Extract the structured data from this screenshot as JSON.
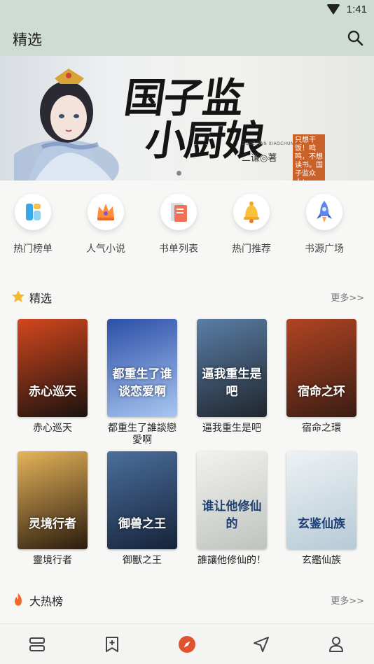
{
  "status": {
    "time": "1:41"
  },
  "appbar": {
    "title": "精选"
  },
  "banner": {
    "title_line1": "国子监",
    "title_line2": "小厨娘",
    "author": "二谦◎著",
    "pinyin": "GUOZIJIAN XIAOCHUNIANG",
    "tagline": "只想干饭！鸣鸣，不想读书。国子监众人："
  },
  "shortcuts": [
    {
      "label": "热门榜单",
      "icon": "chart-icon",
      "color": "#4fb6e8"
    },
    {
      "label": "人气小说",
      "icon": "crown-icon",
      "color": "#ff7b4a"
    },
    {
      "label": "书单列表",
      "icon": "booklist-icon",
      "color": "#f06a4e"
    },
    {
      "label": "热门推荐",
      "icon": "bell-icon",
      "color": "#f6b93b"
    },
    {
      "label": "书源广场",
      "icon": "rocket-icon",
      "color": "#6c8ef0"
    }
  ],
  "featured": {
    "title": "精选",
    "more": "更多>>",
    "books": [
      {
        "title": "赤心巡天",
        "cover_text": "赤心巡天",
        "c1": "#d3471d",
        "c2": "#1a1210"
      },
      {
        "title": "都重生了誰談戀愛啊",
        "cover_text": "都重生了谁谈恋爱啊",
        "c1": "#2b4fa8",
        "c2": "#a9c6f0"
      },
      {
        "title": "逼我重生是吧",
        "cover_text": "逼我重生是吧",
        "c1": "#5a7ea6",
        "c2": "#20262e"
      },
      {
        "title": "宿命之環",
        "cover_text": "宿命之环",
        "c1": "#b04422",
        "c2": "#3a1d14"
      },
      {
        "title": "靈境行者",
        "cover_text": "灵境行者",
        "c1": "#e6b45a",
        "c2": "#2a1b0e"
      },
      {
        "title": "御獸之王",
        "cover_text": "御兽之王",
        "c1": "#4b6f9c",
        "c2": "#16233a"
      },
      {
        "title": "誰讓他修仙的！",
        "cover_text": "谁让他修仙的",
        "c1": "#f2f2ee",
        "c2": "#bfc3bf"
      },
      {
        "title": "玄鑑仙族",
        "cover_text": "玄鉴仙族",
        "c1": "#eef2f4",
        "c2": "#b6cad6"
      }
    ]
  },
  "hot": {
    "title": "大热榜",
    "more": "更多>>"
  },
  "tabs": [
    "bookshelf-icon",
    "bookmark-add-icon",
    "discover-icon",
    "navigate-icon",
    "profile-icon"
  ]
}
